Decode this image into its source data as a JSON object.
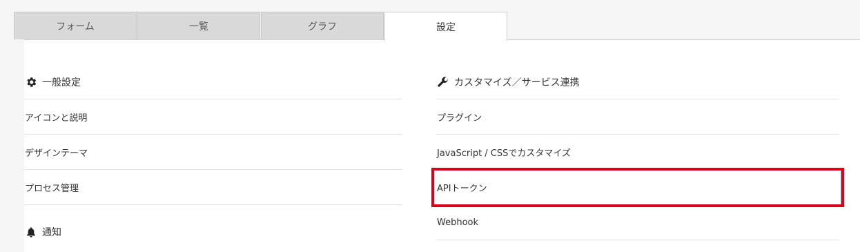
{
  "tabs": [
    {
      "label": "フォーム"
    },
    {
      "label": "一覧"
    },
    {
      "label": "グラフ"
    },
    {
      "label": "設定"
    }
  ],
  "general": {
    "title": "一般設定",
    "items": [
      "アイコンと説明",
      "デザインテーマ",
      "プロセス管理"
    ]
  },
  "notification": {
    "title": "通知"
  },
  "customize": {
    "title": "カスタマイズ／サービス連携",
    "items": [
      "プラグイン",
      "JavaScript / CSSでカスタマイズ",
      "APIトークン",
      "Webhook"
    ]
  },
  "colors": {
    "highlight": "#d9001b",
    "tab_inactive": "#d9d9d9",
    "tab_active": "#ffffff"
  }
}
